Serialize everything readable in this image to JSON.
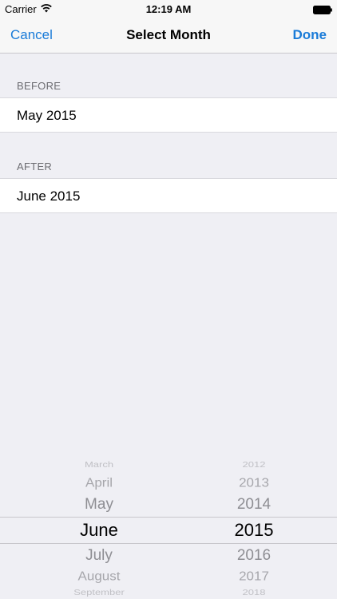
{
  "status_bar": {
    "carrier": "Carrier",
    "time": "12:19 AM"
  },
  "nav": {
    "cancel_label": "Cancel",
    "title": "Select Month",
    "done_label": "Done"
  },
  "sections": [
    {
      "header": "BEFORE",
      "value": "May 2015"
    },
    {
      "header": "AFTER",
      "value": "June 2015"
    }
  ],
  "picker": {
    "months": [
      "March",
      "April",
      "May",
      "June",
      "July",
      "August",
      "September"
    ],
    "years": [
      "2012",
      "2013",
      "2014",
      "2015",
      "2016",
      "2017",
      "2018"
    ],
    "selected_month": "June",
    "selected_year": "2015"
  },
  "colors": {
    "accent": "#1a7bd8",
    "background": "#efeff4"
  },
  "icons": [
    "wifi-icon",
    "battery-icon"
  ]
}
